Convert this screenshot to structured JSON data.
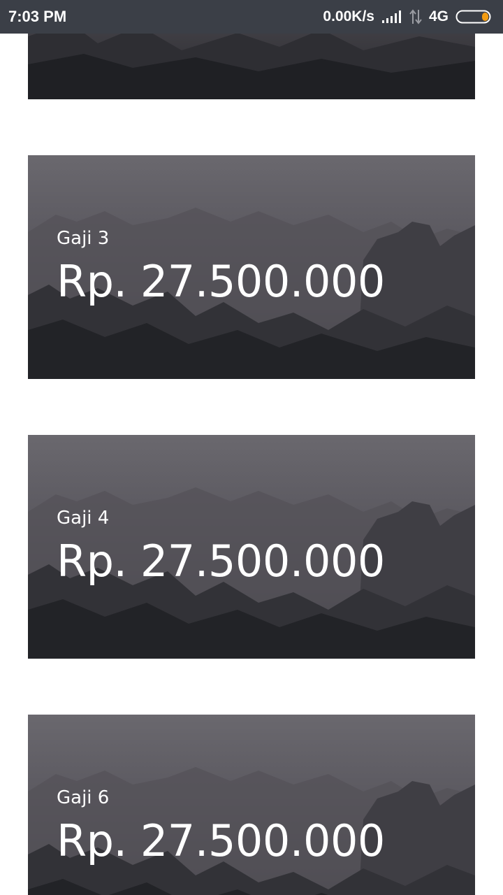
{
  "status_bar": {
    "time": "7:03 PM",
    "network_speed": "0.00K/s",
    "network_type": "4G",
    "icons": [
      "signal-bars-icon",
      "data-arrows-icon",
      "battery-icon"
    ],
    "battery_accent": "#f39c12"
  },
  "cards": [
    {
      "label": "",
      "amount": ""
    },
    {
      "label": "Gaji 3",
      "amount": "Rp. 27.500.000"
    },
    {
      "label": "Gaji 4",
      "amount": "Rp. 27.500.000"
    },
    {
      "label": "Gaji 6",
      "amount": "Rp. 27.500.000"
    }
  ],
  "colors": {
    "status_bar_bg": "#3b3f47",
    "page_bg": "#ffffff",
    "card_text": "#ffffff"
  }
}
